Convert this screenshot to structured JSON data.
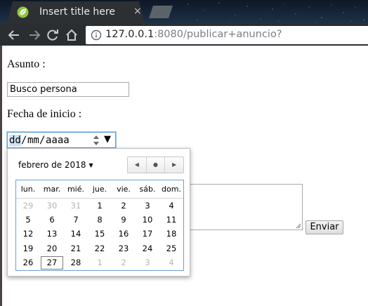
{
  "browser": {
    "tab_title": "Insert title here",
    "tab_close": "×",
    "url_host": "127.0.0.1",
    "url_rest": ":8080/publicar+anuncio?",
    "back_icon": "arrow-left-icon",
    "forward_icon": "arrow-right-icon",
    "reload_icon": "reload-icon",
    "home_icon": "home-icon"
  },
  "form": {
    "asunto_label": "Asunto :",
    "asunto_value": "Busco persona",
    "fecha_label": "Fecha de inicio :",
    "date_day": "dd",
    "date_sep1": "/",
    "date_month": "mm",
    "date_sep2": "/",
    "date_year": "aaaa",
    "dropdown_arrow": "▼",
    "submit_label": "Enviar"
  },
  "calendar": {
    "month_label": "febrero de 2018",
    "weekdays": [
      "lun.",
      "mar.",
      "mié.",
      "jue.",
      "vie.",
      "sáb.",
      "dom."
    ],
    "weeks": [
      [
        "29",
        "30",
        "31",
        "1",
        "2",
        "3",
        "4"
      ],
      [
        "5",
        "6",
        "7",
        "8",
        "9",
        "10",
        "11"
      ],
      [
        "12",
        "13",
        "14",
        "15",
        "16",
        "17",
        "18"
      ],
      [
        "19",
        "20",
        "21",
        "22",
        "23",
        "24",
        "25"
      ],
      [
        "26",
        "27",
        "28",
        "1",
        "2",
        "3",
        "4"
      ]
    ],
    "today": "27"
  },
  "colors": {
    "tab_bg": "#2c3033",
    "toolbar_bg": "#2b2e31",
    "calendar_border": "#6e9fd8",
    "date_focus": "#5e9ed6"
  }
}
